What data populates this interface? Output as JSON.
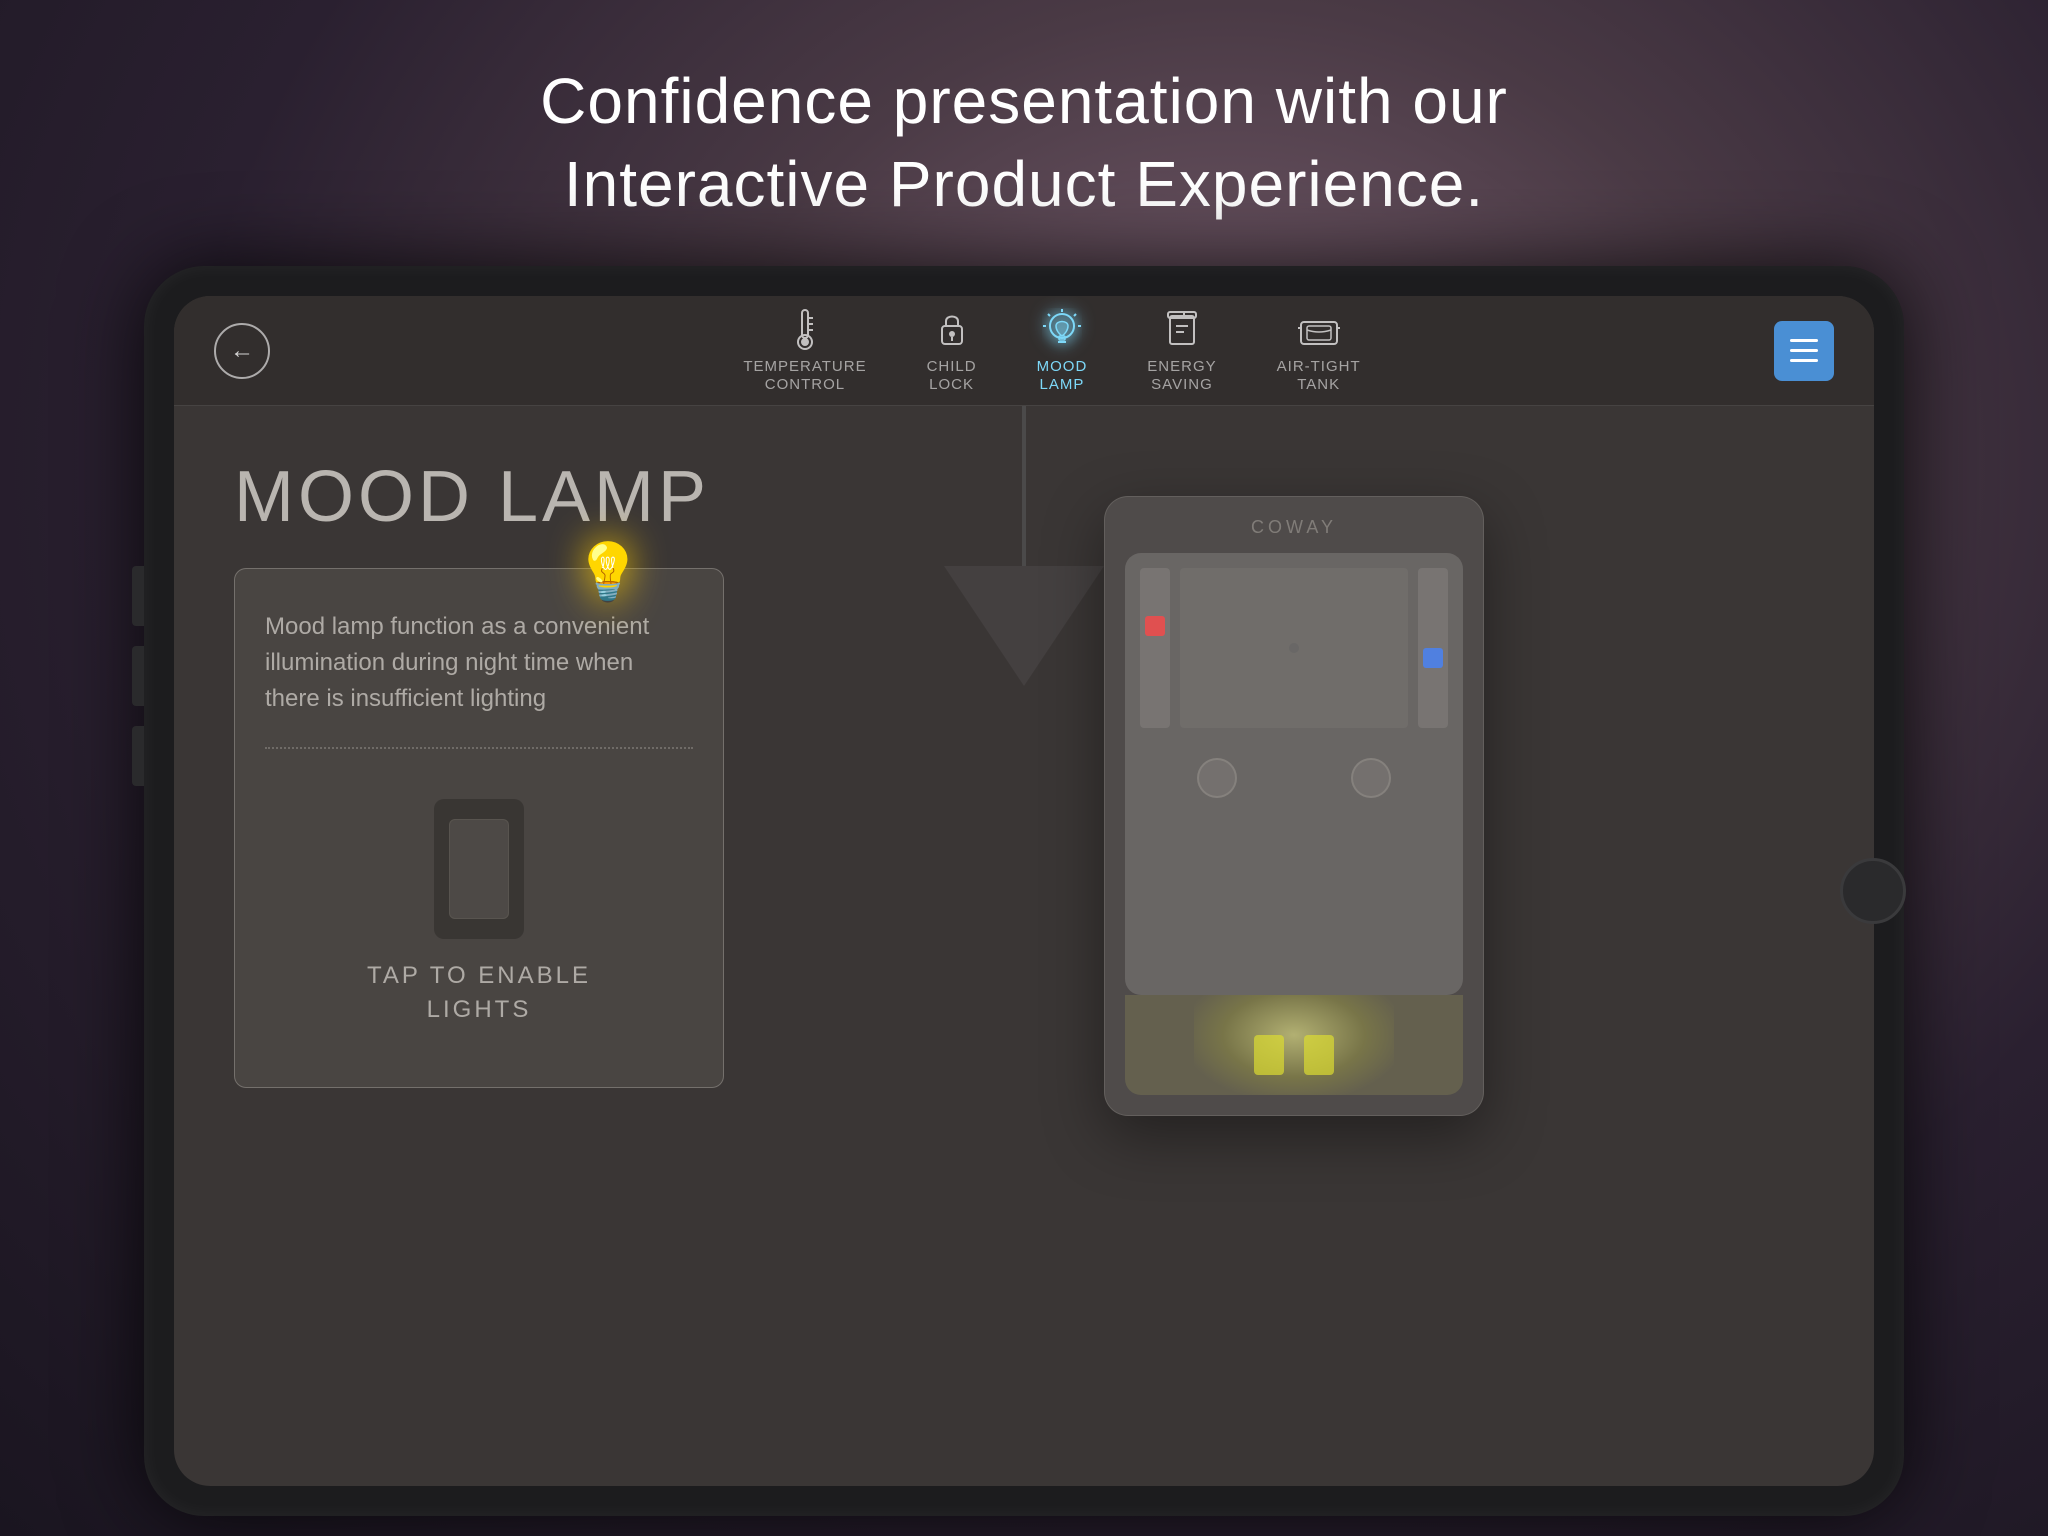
{
  "page": {
    "headline_line1": "Confidence presentation with our",
    "headline_line2": "Interactive Product Experience."
  },
  "nav": {
    "back_label": "←",
    "items": [
      {
        "id": "temperature",
        "icon": "🌡",
        "label": "TEMPERATURE\nCONTROL",
        "active": false
      },
      {
        "id": "child-lock",
        "icon": "🔒",
        "label": "CHILD\nLOCK",
        "active": false
      },
      {
        "id": "mood-lamp",
        "icon": "💡",
        "label": "MOOD\nLAMP",
        "active": true
      },
      {
        "id": "energy-saving",
        "icon": "🔋",
        "label": "ENERGY\nSAVING",
        "active": false
      },
      {
        "id": "air-tight",
        "icon": "🛁",
        "label": "AIR-TIGHT\nTANK",
        "active": false
      }
    ],
    "menu_label": "≡"
  },
  "feature": {
    "title": "MOOD LAMP",
    "description": "Mood lamp function as a convenient illumination during night time when there is insufficient lighting",
    "cta": "TAP TO ENABLE\nLIGHTS"
  },
  "device": {
    "brand": "COWAY"
  },
  "colors": {
    "active_nav": "#7dd8f8",
    "bg_dark": "#3a3635",
    "nav_bg": "#322e2d",
    "accent_blue": "#4a8fd4"
  }
}
